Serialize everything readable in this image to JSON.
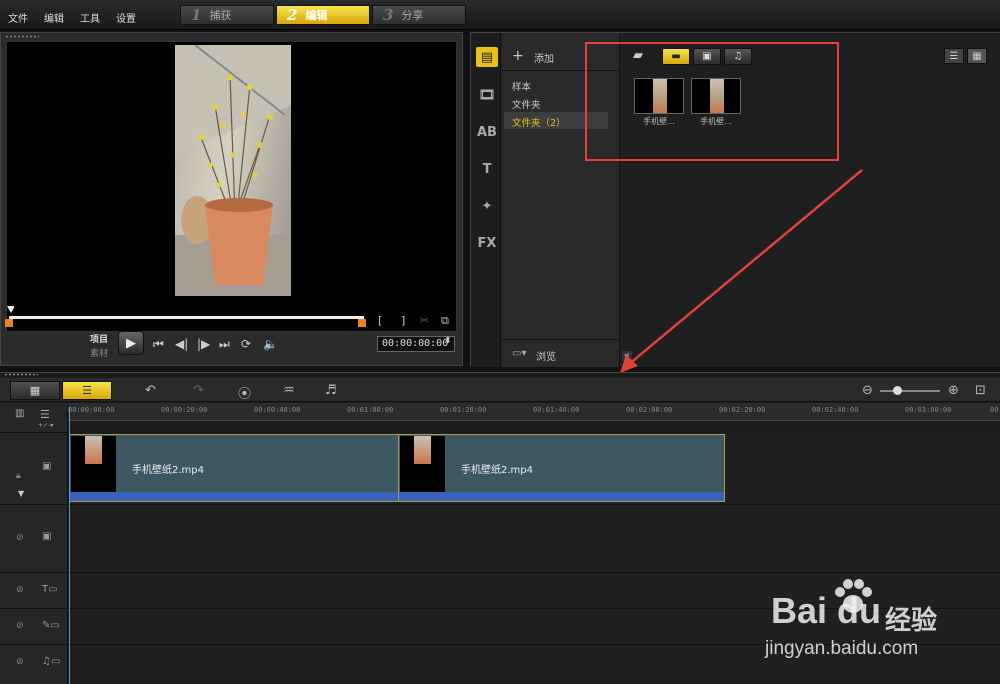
{
  "menu": {
    "file": "文件",
    "edit": "编辑",
    "tools": "工具",
    "settings": "设置"
  },
  "steps": [
    {
      "num": "1",
      "label": "捕获"
    },
    {
      "num": "2",
      "label": "编辑"
    },
    {
      "num": "3",
      "label": "分享"
    }
  ],
  "preview": {
    "mode_project": "项目",
    "mode_clip": "素材",
    "timecode": "00:00:00:00",
    "mark_in": "[",
    "mark_out": "]"
  },
  "library": {
    "add_label": "添加",
    "folders": [
      "样本",
      "文件夹",
      "文件夹（2）"
    ],
    "browse_label": "浏览",
    "thumbnails": [
      {
        "label": "手机壁..."
      },
      {
        "label": "手机壁..."
      }
    ]
  },
  "timeline": {
    "ruler_ticks": [
      "00:00:00:00",
      "00:00:20:00",
      "00:00:40:00",
      "00:01:00:00",
      "00:01:20:00",
      "00:01:40:00",
      "00:02:00:00",
      "00:02:20:00",
      "00:02:40:00",
      "00:03:00:00",
      "00:03:20:00"
    ],
    "clips": [
      {
        "label": "手机壁纸2.mp4"
      },
      {
        "label": "手机壁纸2.mp4"
      }
    ]
  },
  "watermark": {
    "brand": "Bai du",
    "cn": "经验",
    "url": "jingyan.baidu.com"
  },
  "colors": {
    "accent_yellow": "#e8c21c",
    "callout_red": "#e0413a",
    "clip_fill": "#3d5861",
    "clip_bar": "#3a62b8",
    "folder_selected_text": "#e8c21c"
  }
}
